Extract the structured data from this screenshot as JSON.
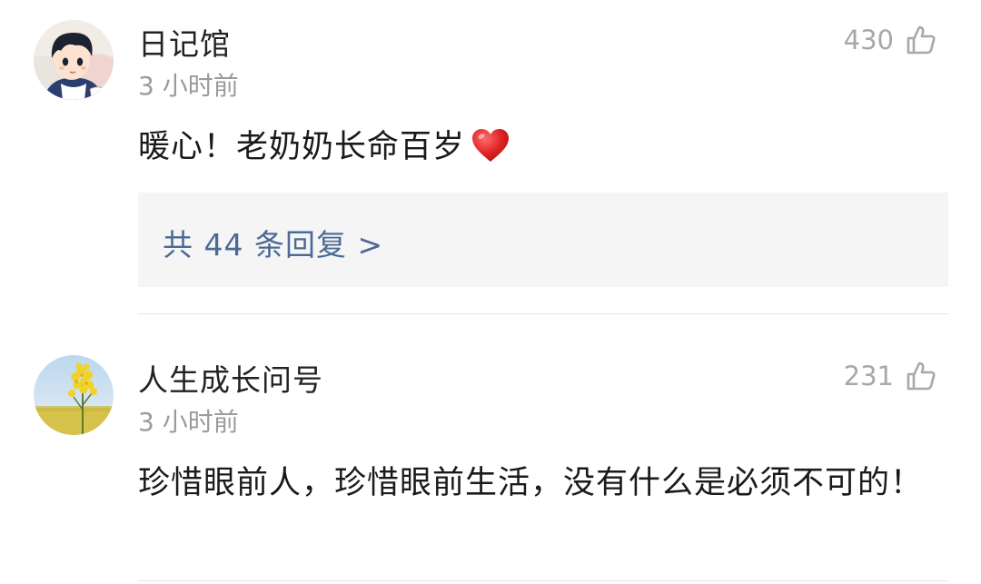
{
  "comments": [
    {
      "username": "日记馆",
      "timestamp": "3 小时前",
      "like_count": "430",
      "text": "暖心！老奶奶长命百岁",
      "emoji": "heart-emoji",
      "reply_link": "共 44 条回复 >"
    },
    {
      "username": "人生成长问号",
      "timestamp": "3 小时前",
      "like_count": "231",
      "text": "珍惜眼前人，珍惜眼前生活，没有什么是必须不可的！"
    }
  ],
  "icons": {
    "like": "thumbs-up-outline-icon",
    "heart": "red-heart-emoji"
  },
  "colors": {
    "link": "#4b6a96",
    "heart": "#e02424",
    "muted": "#9b9b9b"
  }
}
